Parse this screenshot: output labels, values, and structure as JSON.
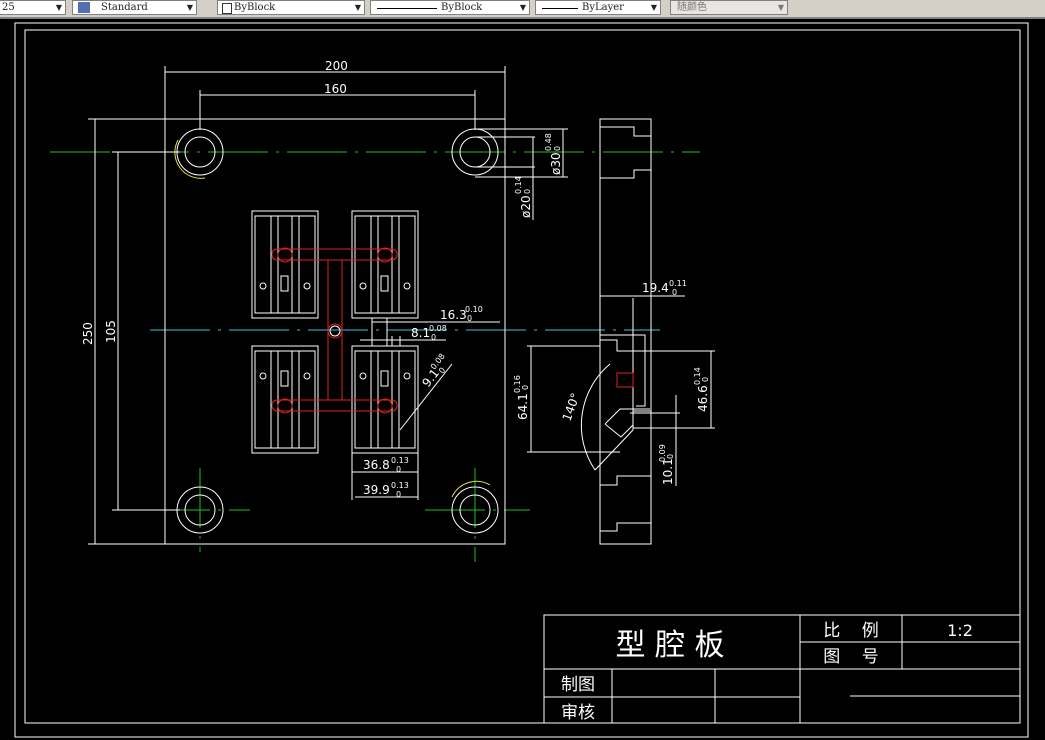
{
  "toolbar": {
    "textstyle_partial": "25",
    "dimstyle": "Standard",
    "layer_color": "ByBlock",
    "linetype": "ByBlock",
    "lineweight": "ByLayer",
    "plot_color": "随颜色"
  },
  "colors": {
    "background": "#000000",
    "lines": "#ffffff",
    "runner": "#e02020",
    "centerline_green": "#20c020",
    "centerline_cyan": "#40c0d0",
    "arc_yellow": "#e0e040"
  },
  "dimensions": {
    "width_overall": "200",
    "hole_spacing_x": "160",
    "height_overall": "250",
    "hole_spacing_y": "105",
    "d30": "ø30",
    "d30_tol_up": "0.48",
    "d30_tol_low": "0",
    "d20": "ø20",
    "d20_tol_up": "0.14",
    "d20_tol_low": "0",
    "d163": "16.3",
    "d163_up": "0.10",
    "d163_low": "0",
    "d81": "8.1",
    "d81_up": "0.08",
    "d81_low": "0",
    "d91": "9.1",
    "d91_up": "0.08",
    "d91_low": "0",
    "d368": "36.8",
    "d368_up": "0.13",
    "d368_low": "0",
    "d399": "39.9",
    "d399_up": "0.13",
    "d399_low": "0",
    "d194": "19.4",
    "d194_up": "0.11",
    "d194_low": "0",
    "d641": "64.1",
    "d641_up": "0.16",
    "d641_low": "0",
    "d466": "46.6",
    "d466_up": "0.14",
    "d466_low": "0",
    "d101": "10.1",
    "d101_up": "0.09",
    "d101_low": "0",
    "angle": "140°"
  },
  "title_block": {
    "title": "型 腔 板",
    "scale_label": "比    例",
    "scale_value": "1:2",
    "drawing_no_label": "图    号",
    "drawn_by_label": "制图",
    "checked_by_label": "审核"
  }
}
